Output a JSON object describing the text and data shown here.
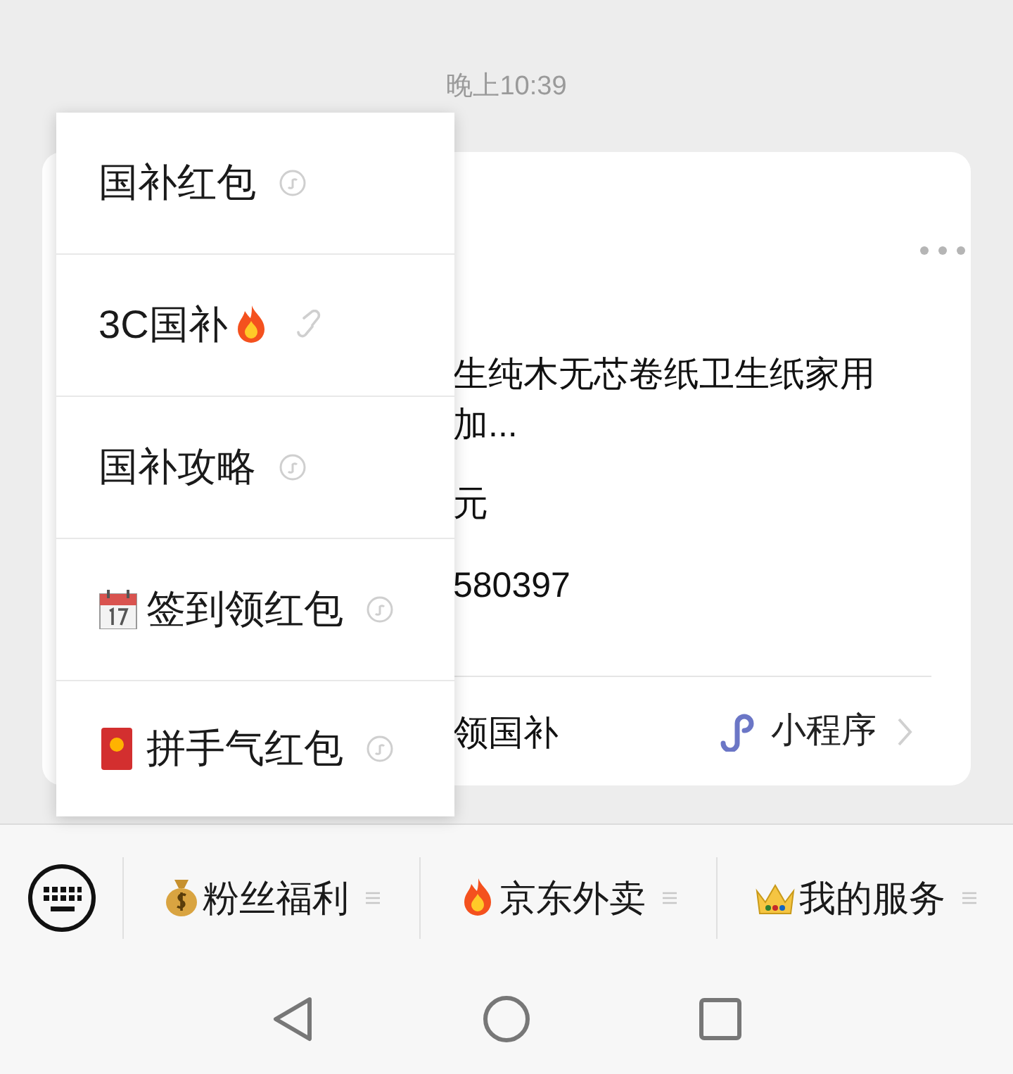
{
  "status_time": "晚上10:39",
  "card": {
    "lines": [
      "生纯木无芯卷纸卫生纸家用",
      "加...",
      "元",
      "580397"
    ],
    "footer_text": "领国补",
    "footer_source": "小程序"
  },
  "menu": {
    "items": [
      {
        "label": "国补红包"
      },
      {
        "label": "3C国补"
      },
      {
        "label": "国补攻略"
      },
      {
        "label": "签到领红包"
      },
      {
        "label": "拼手气红包"
      }
    ]
  },
  "bottom_menu": [
    {
      "label": "粉丝福利"
    },
    {
      "label": "京东外卖"
    },
    {
      "label": "我的服务"
    }
  ]
}
